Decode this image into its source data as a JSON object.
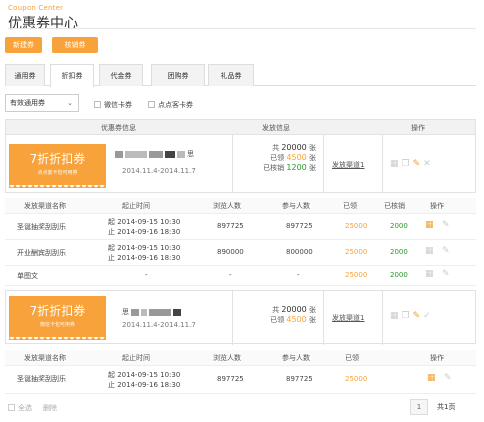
{
  "header": {
    "subtitle_en": "Coupon Center",
    "title": "优惠券中心"
  },
  "actions": {
    "new_label": "新建券",
    "verify_label": "核销券"
  },
  "tabs": [
    {
      "label": "通用券"
    },
    {
      "label": "折扣券",
      "active": true
    },
    {
      "label": "代金券"
    },
    {
      "label": "团购券"
    },
    {
      "label": "礼品券"
    }
  ],
  "filter": {
    "selected": "有效通用券",
    "checkbox1": "微信卡券",
    "checkbox2": "点点客卡券"
  },
  "table_head": {
    "col1": "优惠券信息",
    "col2": "发放信息",
    "col3": "操作"
  },
  "coupons": [
    {
      "ticket_big": "7折折扣券",
      "ticket_small": "点点客卡包可用券",
      "name_suffix": "思",
      "date_range": "2014.11.4-2014.11.7",
      "issue_total_label": "共",
      "issue_total": "20000",
      "issue_unit": "张",
      "received_label": "已领",
      "received": "4500",
      "verified_label": "已核销",
      "verified": "1200",
      "channel_link": "发放渠道1",
      "sub_head": {
        "name": "发放渠道名称",
        "time": "起止时间",
        "views": "浏览人数",
        "participants": "参与人数",
        "received": "已领",
        "verified": "已核销",
        "ops": "操作"
      },
      "rows": [
        {
          "name": "圣诞抽奖刮刮乐",
          "start": "起 2014-09-15  10:30",
          "end": "止 2014-09-16  18:30",
          "views": "897725",
          "participants": "897725",
          "received": "25000",
          "verified": "2000"
        },
        {
          "name": "开业酬宾刮刮乐",
          "start": "起 2014-09-15  10:30",
          "end": "止 2014-09-16  18:30",
          "views": "890000",
          "participants": "800000",
          "received": "25000",
          "verified": "2000"
        },
        {
          "name": "单图文",
          "start": "-",
          "end": "",
          "views": "-",
          "participants": "-",
          "received": "25000",
          "verified": "2000"
        }
      ]
    },
    {
      "ticket_big": "7折折扣券",
      "ticket_small": "微信卡包可用券",
      "name_prefix": "思",
      "date_range": "2014.11.4-2014.11.7",
      "issue_total_label": "共",
      "issue_total": "20000",
      "issue_unit": "张",
      "received_label": "已领",
      "received": "4500",
      "channel_link": "发放渠道1",
      "sub_head": {
        "name": "发放渠道名称",
        "time": "起止时间",
        "views": "浏览人数",
        "participants": "参与人数",
        "received": "已领",
        "ops": "操作"
      },
      "rows": [
        {
          "name": "圣诞抽奖刮刮乐",
          "start": "起 2014-09-15  10:30",
          "end": "止 2014-09-16  18:30",
          "views": "897725",
          "participants": "897725",
          "received": "25000"
        }
      ]
    }
  ],
  "footer": {
    "select_all": "全选",
    "delete": "删除",
    "page": "1",
    "total": "共1页"
  },
  "colors": {
    "accent": "#f7a23a",
    "green": "#2a9a2a"
  }
}
